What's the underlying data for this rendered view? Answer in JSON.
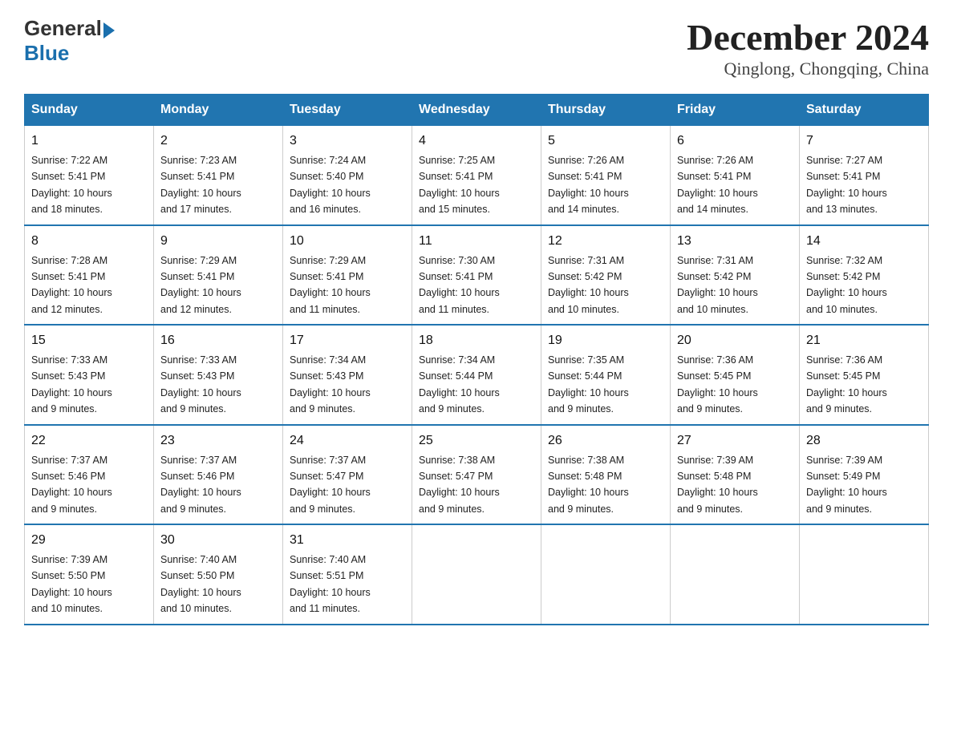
{
  "logo": {
    "general": "General",
    "blue": "Blue"
  },
  "title": {
    "month_year": "December 2024",
    "location": "Qinglong, Chongqing, China"
  },
  "days_of_week": [
    "Sunday",
    "Monday",
    "Tuesday",
    "Wednesday",
    "Thursday",
    "Friday",
    "Saturday"
  ],
  "weeks": [
    [
      {
        "day": "1",
        "sunrise": "7:22 AM",
        "sunset": "5:41 PM",
        "daylight": "10 hours and 18 minutes."
      },
      {
        "day": "2",
        "sunrise": "7:23 AM",
        "sunset": "5:41 PM",
        "daylight": "10 hours and 17 minutes."
      },
      {
        "day": "3",
        "sunrise": "7:24 AM",
        "sunset": "5:40 PM",
        "daylight": "10 hours and 16 minutes."
      },
      {
        "day": "4",
        "sunrise": "7:25 AM",
        "sunset": "5:41 PM",
        "daylight": "10 hours and 15 minutes."
      },
      {
        "day": "5",
        "sunrise": "7:26 AM",
        "sunset": "5:41 PM",
        "daylight": "10 hours and 14 minutes."
      },
      {
        "day": "6",
        "sunrise": "7:26 AM",
        "sunset": "5:41 PM",
        "daylight": "10 hours and 14 minutes."
      },
      {
        "day": "7",
        "sunrise": "7:27 AM",
        "sunset": "5:41 PM",
        "daylight": "10 hours and 13 minutes."
      }
    ],
    [
      {
        "day": "8",
        "sunrise": "7:28 AM",
        "sunset": "5:41 PM",
        "daylight": "10 hours and 12 minutes."
      },
      {
        "day": "9",
        "sunrise": "7:29 AM",
        "sunset": "5:41 PM",
        "daylight": "10 hours and 12 minutes."
      },
      {
        "day": "10",
        "sunrise": "7:29 AM",
        "sunset": "5:41 PM",
        "daylight": "10 hours and 11 minutes."
      },
      {
        "day": "11",
        "sunrise": "7:30 AM",
        "sunset": "5:41 PM",
        "daylight": "10 hours and 11 minutes."
      },
      {
        "day": "12",
        "sunrise": "7:31 AM",
        "sunset": "5:42 PM",
        "daylight": "10 hours and 10 minutes."
      },
      {
        "day": "13",
        "sunrise": "7:31 AM",
        "sunset": "5:42 PM",
        "daylight": "10 hours and 10 minutes."
      },
      {
        "day": "14",
        "sunrise": "7:32 AM",
        "sunset": "5:42 PM",
        "daylight": "10 hours and 10 minutes."
      }
    ],
    [
      {
        "day": "15",
        "sunrise": "7:33 AM",
        "sunset": "5:43 PM",
        "daylight": "10 hours and 9 minutes."
      },
      {
        "day": "16",
        "sunrise": "7:33 AM",
        "sunset": "5:43 PM",
        "daylight": "10 hours and 9 minutes."
      },
      {
        "day": "17",
        "sunrise": "7:34 AM",
        "sunset": "5:43 PM",
        "daylight": "10 hours and 9 minutes."
      },
      {
        "day": "18",
        "sunrise": "7:34 AM",
        "sunset": "5:44 PM",
        "daylight": "10 hours and 9 minutes."
      },
      {
        "day": "19",
        "sunrise": "7:35 AM",
        "sunset": "5:44 PM",
        "daylight": "10 hours and 9 minutes."
      },
      {
        "day": "20",
        "sunrise": "7:36 AM",
        "sunset": "5:45 PM",
        "daylight": "10 hours and 9 minutes."
      },
      {
        "day": "21",
        "sunrise": "7:36 AM",
        "sunset": "5:45 PM",
        "daylight": "10 hours and 9 minutes."
      }
    ],
    [
      {
        "day": "22",
        "sunrise": "7:37 AM",
        "sunset": "5:46 PM",
        "daylight": "10 hours and 9 minutes."
      },
      {
        "day": "23",
        "sunrise": "7:37 AM",
        "sunset": "5:46 PM",
        "daylight": "10 hours and 9 minutes."
      },
      {
        "day": "24",
        "sunrise": "7:37 AM",
        "sunset": "5:47 PM",
        "daylight": "10 hours and 9 minutes."
      },
      {
        "day": "25",
        "sunrise": "7:38 AM",
        "sunset": "5:47 PM",
        "daylight": "10 hours and 9 minutes."
      },
      {
        "day": "26",
        "sunrise": "7:38 AM",
        "sunset": "5:48 PM",
        "daylight": "10 hours and 9 minutes."
      },
      {
        "day": "27",
        "sunrise": "7:39 AM",
        "sunset": "5:48 PM",
        "daylight": "10 hours and 9 minutes."
      },
      {
        "day": "28",
        "sunrise": "7:39 AM",
        "sunset": "5:49 PM",
        "daylight": "10 hours and 9 minutes."
      }
    ],
    [
      {
        "day": "29",
        "sunrise": "7:39 AM",
        "sunset": "5:50 PM",
        "daylight": "10 hours and 10 minutes."
      },
      {
        "day": "30",
        "sunrise": "7:40 AM",
        "sunset": "5:50 PM",
        "daylight": "10 hours and 10 minutes."
      },
      {
        "day": "31",
        "sunrise": "7:40 AM",
        "sunset": "5:51 PM",
        "daylight": "10 hours and 11 minutes."
      },
      null,
      null,
      null,
      null
    ]
  ],
  "labels": {
    "sunrise": "Sunrise:",
    "sunset": "Sunset:",
    "daylight": "Daylight:"
  }
}
